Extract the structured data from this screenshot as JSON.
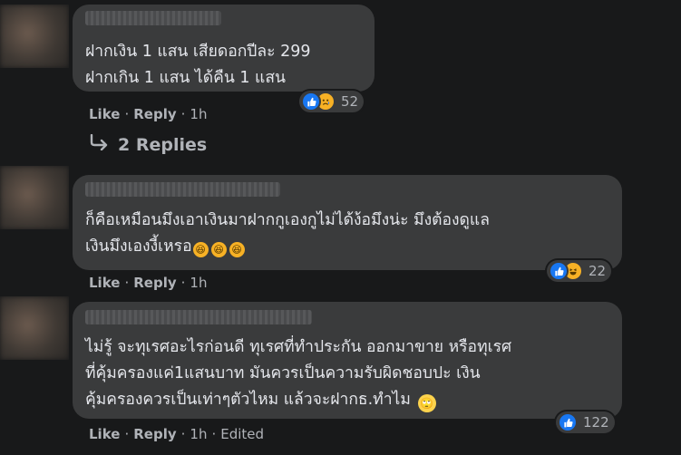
{
  "comments": [
    {
      "text": "ฝากเงิน 1 แสน เสียดอกปีละ 299\nฝากเกิน 1 แสน ได้คืน 1 แสน",
      "reaction_count": "52",
      "like_label": "Like",
      "reply_label": "Reply",
      "time": "1h"
    },
    {
      "text": "ก็คือเหมือนมึงเอาเงินมาฝากกูเองกูไม่ได้ง้อมึงน่ะ มึงต้องดูแล\nเงินมึงเองงี้เหรอ",
      "inline_emojis": [
        "🤣",
        "🤣",
        "🤣"
      ],
      "reaction_count": "22",
      "like_label": "Like",
      "reply_label": "Reply",
      "time": "1h"
    },
    {
      "text": "ไม่รู้ จะทุเรศอะไรก่อนดี ทุเรศที่ทำประกัน ออกมาขาย หรือทุเรศ\nที่คุ้มครองแค่1แสนบาท มันควรเป็นความรับผิดชอบปะ เงิน\nคุ้มครองควรเป็นเท่าๆตัวไหม แล้วจะฝากธ.ทำไม",
      "trailing_emoji": "🙄",
      "reaction_count": "122",
      "like_label": "Like",
      "reply_label": "Reply",
      "time": "1h",
      "edited_label": "Edited"
    }
  ],
  "replies_link": "2 Replies",
  "icons": {
    "like": "thumbs-up-icon",
    "sad": "sad-face-icon",
    "haha": "laughing-face-icon",
    "reply_arrow": "reply-arrow-icon"
  },
  "colors": {
    "background": "#18191a",
    "bubble": "#3a3b3c",
    "like_blue": "#1877f2",
    "emoji_yellow": "#f7b125"
  }
}
